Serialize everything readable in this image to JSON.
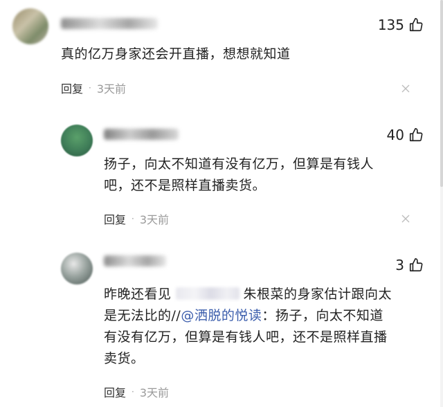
{
  "comments": [
    {
      "likes": "135",
      "text": "真的亿万身家还会开直播，想想就知道",
      "reply_label": "回复",
      "separator": "·",
      "time": "3天前"
    },
    {
      "likes": "40",
      "text_line1": "扬子，向太不知道有没有亿万，但算是有钱人",
      "text_line2": "吧，还不是照样直播卖货。",
      "reply_label": "回复",
      "separator": "·",
      "time": "3天前"
    },
    {
      "likes": "3",
      "text_line1_a": "昨晚还看见",
      "text_line1_b": "朱根菜的身家估计跟向太",
      "text_line2_a": "是无法比的//",
      "mention": "@洒脱的悦读",
      "text_line2_b": "：扬子，向太不知道",
      "text_line3": "有没有亿万，但算是有钱人吧，还不是照样直播",
      "text_line4": "卖货。",
      "reply_label": "回复",
      "separator": "·",
      "time": "3天前"
    }
  ],
  "colors": {
    "text": "#222222",
    "muted": "#9a9a9a",
    "mention": "#3b5dac"
  },
  "icons": {
    "like": "thumbs-up-icon",
    "close": "close-icon"
  }
}
